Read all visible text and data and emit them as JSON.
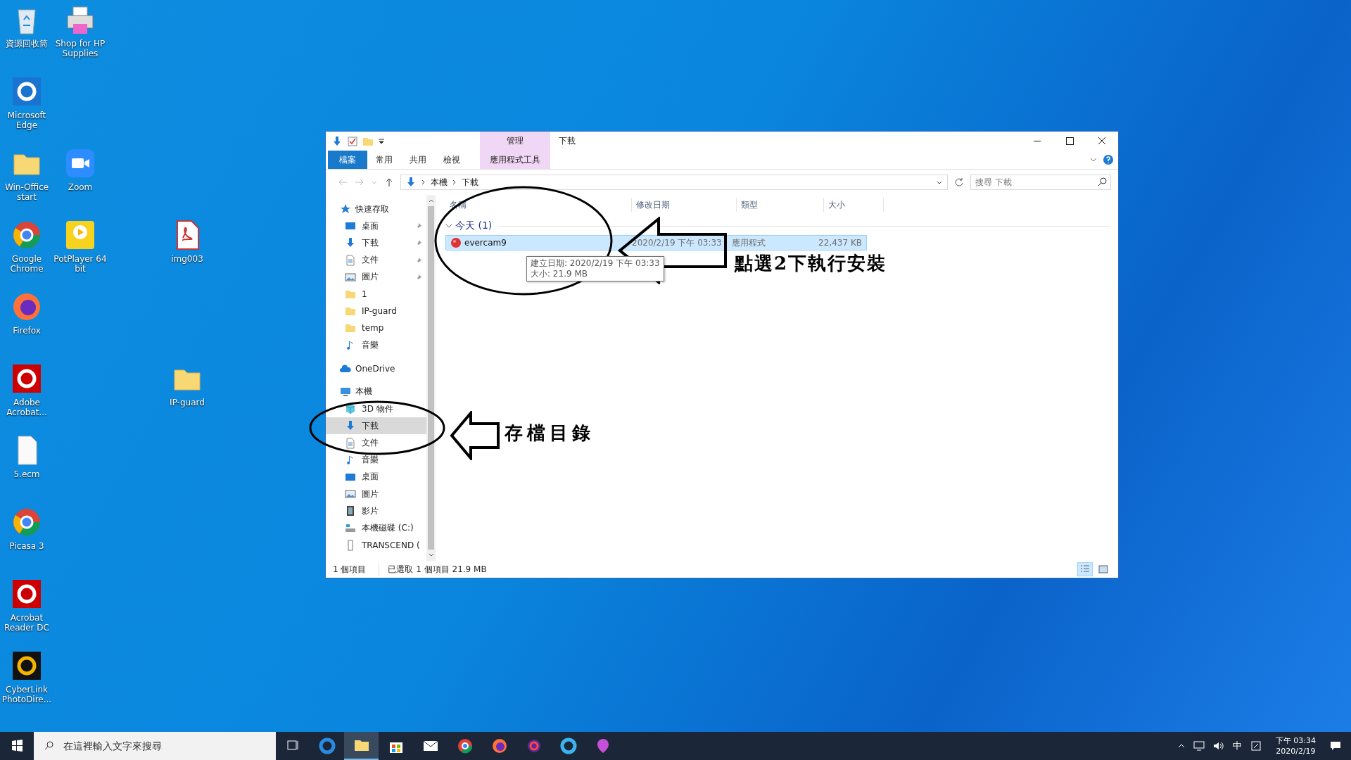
{
  "desktop_icons": [
    {
      "label": "資源回收筒"
    },
    {
      "label": "Shop for HP Supplies"
    },
    {
      "label": "Microsoft Edge"
    },
    {
      "label": "Win-Office start"
    },
    {
      "label": "Zoom"
    },
    {
      "label": "Google Chrome"
    },
    {
      "label": "PotPlayer 64 bit"
    },
    {
      "label": "img003"
    },
    {
      "label": "Firefox"
    },
    {
      "label": "Adobe Acrobat..."
    },
    {
      "label": "IP-guard"
    },
    {
      "label": "5.ecm"
    },
    {
      "label": "Picasa 3"
    },
    {
      "label": "Acrobat Reader DC"
    },
    {
      "label": "CyberLink PhotoDire..."
    }
  ],
  "window": {
    "title": "下載",
    "context_tab": "管理",
    "ribbon_tabs": [
      {
        "label": "檔案",
        "kind": "file"
      },
      {
        "label": "常用",
        "kind": "plain"
      },
      {
        "label": "共用",
        "kind": "plain"
      },
      {
        "label": "檢視",
        "kind": "plain"
      },
      {
        "label": "應用程式工具",
        "kind": "context"
      }
    ],
    "address": {
      "crumbs": [
        "本機",
        "下載"
      ]
    },
    "search": {
      "placeholder": "搜尋 下載"
    },
    "nav": [
      {
        "label": "快速存取",
        "selected": false,
        "children": [
          {
            "label": "桌面",
            "pinned": true,
            "selected": false
          },
          {
            "label": "下載",
            "pinned": true,
            "selected": false
          },
          {
            "label": "文件",
            "pinned": true,
            "selected": false
          },
          {
            "label": "圖片",
            "pinned": true,
            "selected": false
          },
          {
            "label": "1",
            "pinned": false,
            "selected": false
          },
          {
            "label": "IP-guard",
            "pinned": false,
            "selected": false
          },
          {
            "label": "temp",
            "pinned": false,
            "selected": false
          },
          {
            "label": "音樂",
            "pinned": false,
            "selected": false
          }
        ]
      },
      {
        "label": "OneDrive",
        "selected": false
      },
      {
        "label": "本機",
        "selected": false,
        "children": [
          {
            "label": "3D 物件",
            "selected": false
          },
          {
            "label": "下載",
            "selected": true
          },
          {
            "label": "文件",
            "selected": false
          },
          {
            "label": "音樂",
            "selected": false
          },
          {
            "label": "桌面",
            "selected": false
          },
          {
            "label": "圖片",
            "selected": false
          },
          {
            "label": "影片",
            "selected": false
          },
          {
            "label": "本機磁碟 (C:)",
            "selected": false
          },
          {
            "label": "TRANSCEND (",
            "selected": false
          }
        ]
      }
    ],
    "columns": [
      "名稱",
      "修改日期",
      "類型",
      "大小"
    ],
    "group": {
      "label": "今天 (1)",
      "expanded": true
    },
    "files": [
      {
        "name": "evercam9",
        "modified": "2020/2/19 下午 03:33",
        "type": "應用程式",
        "size": "22,437 KB",
        "selected": true
      }
    ],
    "tooltip": {
      "lines": [
        "建立日期: 2020/2/19 下午 03:33",
        "大小: 21.9 MB"
      ]
    },
    "status": {
      "count": "1 個項目",
      "selection": "已選取 1 個項目  21.9 MB"
    },
    "views": [
      {
        "selected": true
      },
      {
        "selected": false
      }
    ]
  },
  "annotations": [
    {
      "text": "點選2下執行安裝"
    },
    {
      "text": "存檔目錄"
    }
  ],
  "taskbar": {
    "search_placeholder": "在這裡輸入文字來搜尋",
    "apps": [
      {
        "selected": false
      },
      {
        "selected": true
      },
      {
        "selected": false
      },
      {
        "selected": false
      },
      {
        "selected": false
      },
      {
        "selected": false
      },
      {
        "selected": false
      },
      {
        "selected": false
      },
      {
        "selected": false
      }
    ],
    "ime": "中",
    "clock": {
      "time": "下午 03:34",
      "date": "2020/2/19"
    }
  }
}
